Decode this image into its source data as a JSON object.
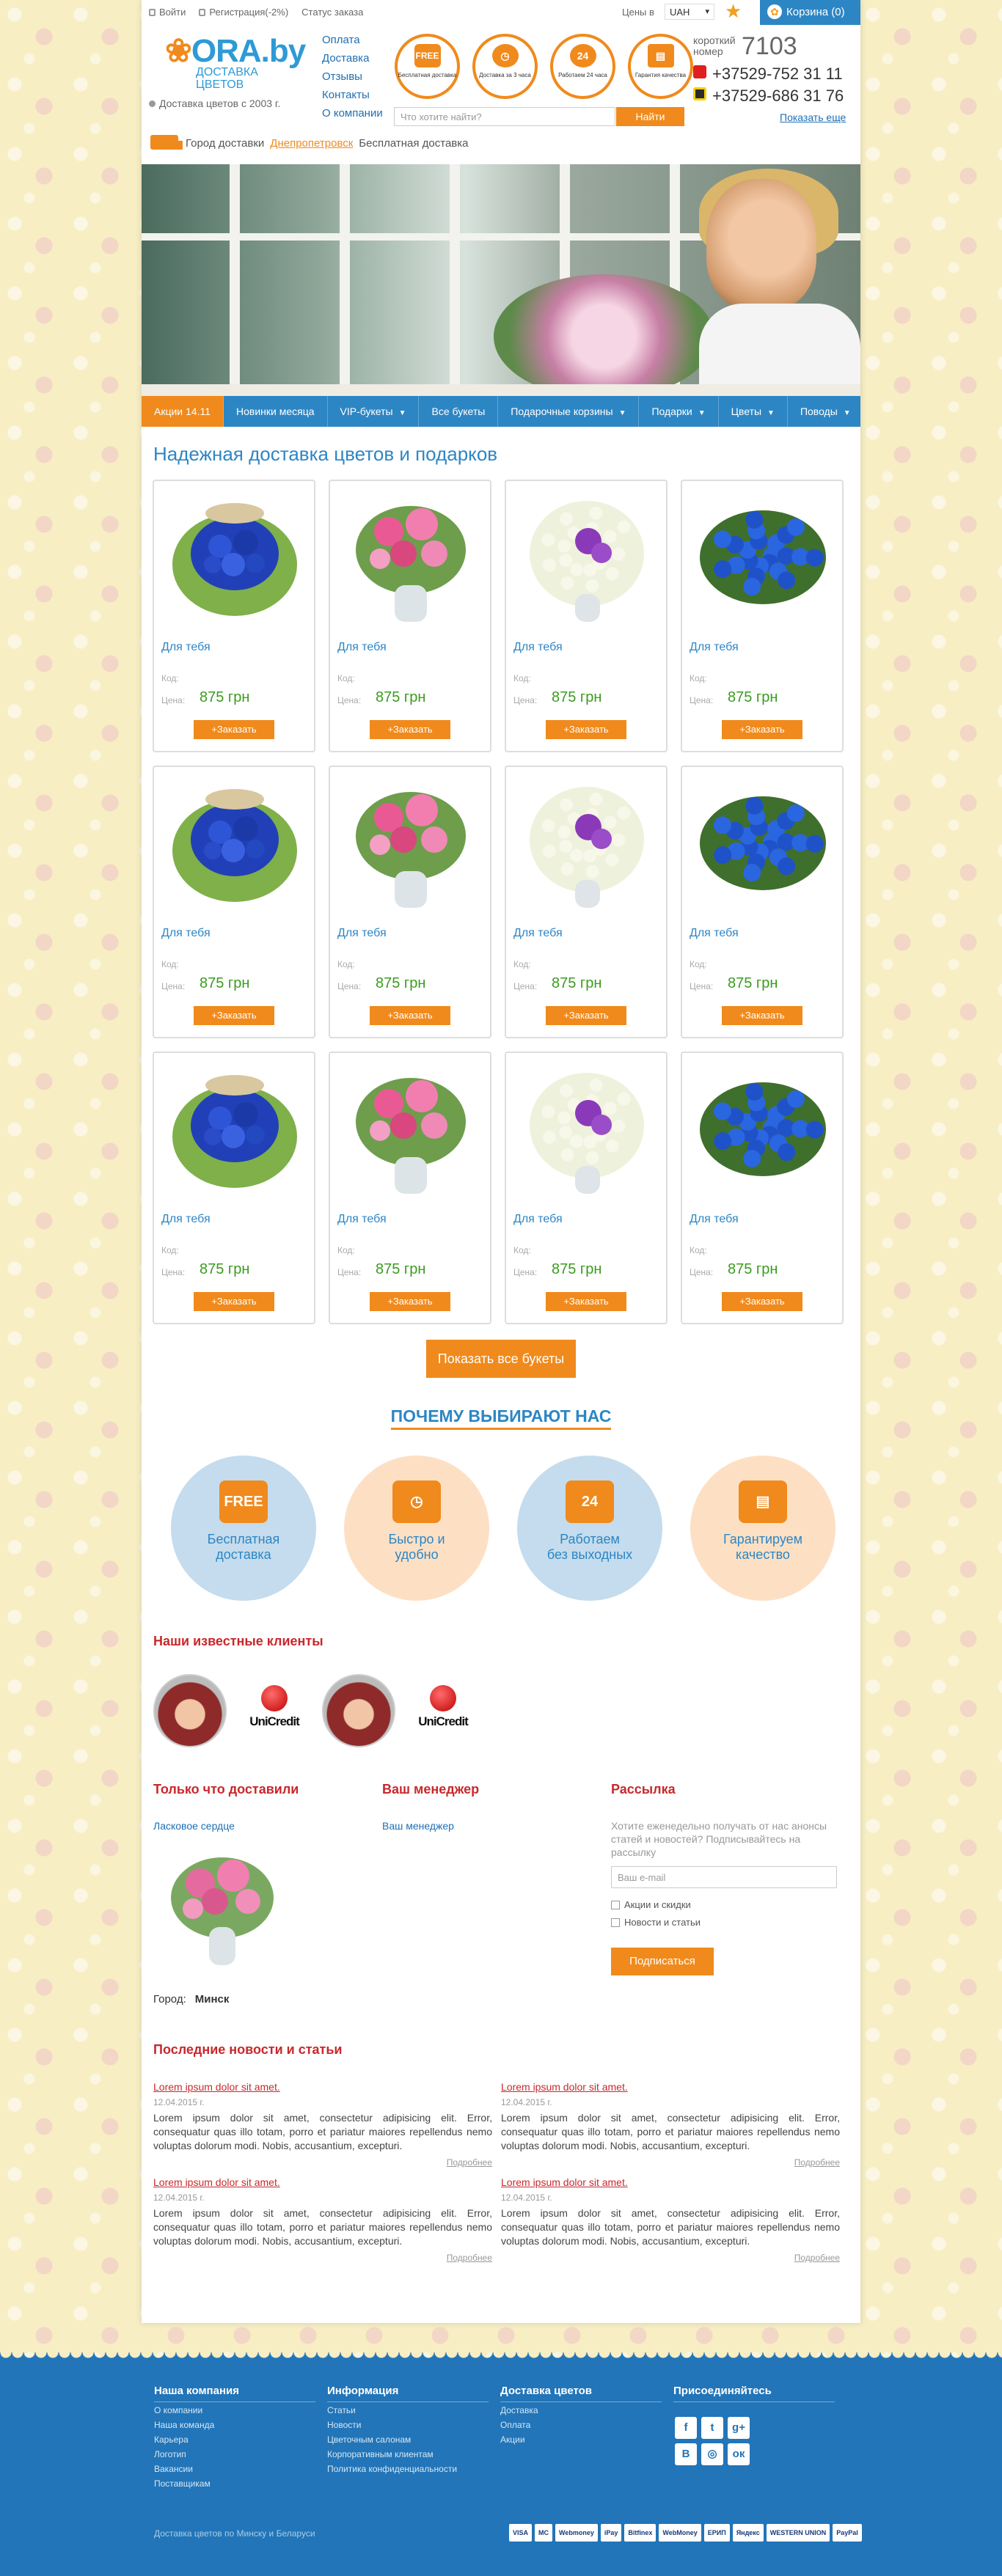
{
  "topbar": {
    "login": "Войти",
    "register": "Регистрация(-2%)",
    "order_status": "Статус заказа",
    "prices_label": "Цены в",
    "currency": "UAH",
    "cart": "Корзина (0)"
  },
  "header": {
    "logo_word": "ORA.by",
    "logo_sub_1": "ДОСТАВКА",
    "logo_sub_2": "ЦВЕТОВ",
    "since": "Доставка цветов с 2003 г.",
    "nav": [
      "Оплата",
      "Доставка",
      "Отзывы",
      "Контакты",
      "О компании"
    ],
    "badges": [
      {
        "icon": "FREE",
        "text": "Бесплатная доставка"
      },
      {
        "icon": "◷",
        "text": "Доставка за 3 часа"
      },
      {
        "icon": "24",
        "text": "Работаем 24 часа"
      },
      {
        "icon": "▤",
        "text": "Гарантия качества"
      }
    ],
    "search_placeholder": "Что хотите найти?",
    "search_button": "Найти",
    "short_label_1": "короткий",
    "short_label_2": "номер",
    "short_number": "7103",
    "phones": [
      "+37529-752 31 11",
      "+37529-686 31 76"
    ],
    "show_more": "Показать еще",
    "city_label": "Город доставки",
    "city": "Днепропетровск",
    "free_delivery": "Бесплатная доставка"
  },
  "menu": [
    {
      "label": "Акции 14.11",
      "caret": false
    },
    {
      "label": "Новинки месяца",
      "caret": false
    },
    {
      "label": "VIP-букеты",
      "caret": true
    },
    {
      "label": "Все букеты",
      "caret": false
    },
    {
      "label": "Подарочные корзины",
      "caret": true
    },
    {
      "label": "Подарки",
      "caret": true
    },
    {
      "label": "Цветы",
      "caret": true
    },
    {
      "label": "Поводы",
      "caret": true
    }
  ],
  "section_title": "Надежная доставка цветов и подарков",
  "product_labels": {
    "title": "Для тебя",
    "kod": "Код:",
    "cena": "Цена:",
    "price": "875 грн",
    "order": "+Заказать"
  },
  "show_all": "Показать все букеты",
  "why": {
    "title": "ПОЧЕМУ ВЫБИРАЮТ НАС",
    "items": [
      {
        "line1": "Бесплатная",
        "line2": "доставка",
        "icon": "FREE"
      },
      {
        "line1": "Быстро и",
        "line2": "удобно",
        "icon": "◷"
      },
      {
        "line1": "Работаем",
        "line2": "без выходных",
        "icon": "24"
      },
      {
        "line1": "Гарантируем",
        "line2": "качество",
        "icon": "▤"
      }
    ]
  },
  "clients": {
    "title": "Наши известные клиенты",
    "brand": "UniCredit"
  },
  "delivered": {
    "title": "Только что доставили",
    "item": "Ласковое сердце",
    "city_label": "Город:",
    "city": "Минск"
  },
  "manager": {
    "title": "Ваш менеджер",
    "link": "Ваш менеджер"
  },
  "newsletter": {
    "title": "Рассылка",
    "desc": "Хотите еженедельно получать от нас анонсы статей и новостей? Подписывайтесь на рассылку",
    "email_placeholder": "Ваш e-mail",
    "opt1": "Акции и скидки",
    "opt2": "Новости и статьи",
    "button": "Подписаться"
  },
  "news": {
    "title": "Последние новости и статьи",
    "headline": "Lorem ipsum dolor sit amet.",
    "date": "12.04.2015 г.",
    "body": "Lorem ipsum dolor sit amet, consectetur adipisicing elit. Error, consequatur quas illo totam, porro et pariatur maiores repellendus nemo voluptas dolorum modi. Nobis, accusantium, excepturi.",
    "more": "Подробнее"
  },
  "footer": {
    "cols": [
      {
        "title": "Наша компания",
        "links": [
          "О компании",
          "Наша команда",
          "Карьера",
          "Логотип",
          "Вакансии",
          "Поставщикам"
        ]
      },
      {
        "title": "Информация",
        "links": [
          "Статьи",
          "Новости",
          "Цветочным салонам",
          "Корпоративным клиентам",
          "Политика конфиденциальности"
        ]
      },
      {
        "title": "Доставка цветов",
        "links": [
          "Доставка",
          "Оплата",
          "Акции"
        ]
      },
      {
        "title": "Присоединяйтесь",
        "links": []
      }
    ],
    "socials": [
      "f",
      "t",
      "g+",
      "В",
      "◎",
      "ок"
    ],
    "bottom": "Доставка цветов по Минску и Беларуси",
    "payments": [
      "VISA",
      "MC",
      "Webmoney",
      "iPay",
      "Bitfinex",
      "WebMoney",
      "ЕРИП",
      "Яндекс",
      "WESTERN UNION",
      "PayPal"
    ]
  }
}
